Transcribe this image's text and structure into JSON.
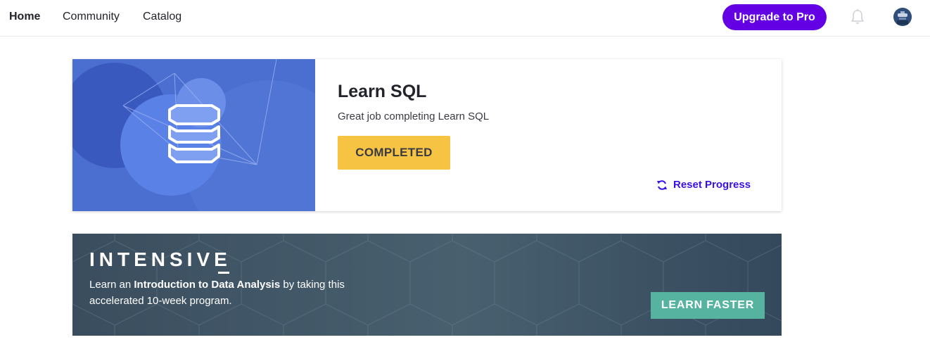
{
  "nav": {
    "links": [
      {
        "label": "Home"
      },
      {
        "label": "Community"
      },
      {
        "label": "Catalog"
      }
    ],
    "upgrade_label": "Upgrade to Pro"
  },
  "course": {
    "title": "Learn SQL",
    "subtitle": "Great job completing Learn SQL",
    "status_label": "COMPLETED",
    "reset_label": "Reset Progress",
    "icon": "database-icon"
  },
  "banner": {
    "heading": "INTENSIVE",
    "text_before": "Learn an ",
    "text_bold": "Introduction to Data Analysis",
    "text_after": " by taking this accelerated 10-week program.",
    "cta_label": "LEARN FASTER"
  },
  "colors": {
    "brand": "#6400e4",
    "completed": "#f6c343",
    "link": "#3a10e5",
    "cta": "#55b3a0",
    "card_art": "#4a6fd1"
  }
}
